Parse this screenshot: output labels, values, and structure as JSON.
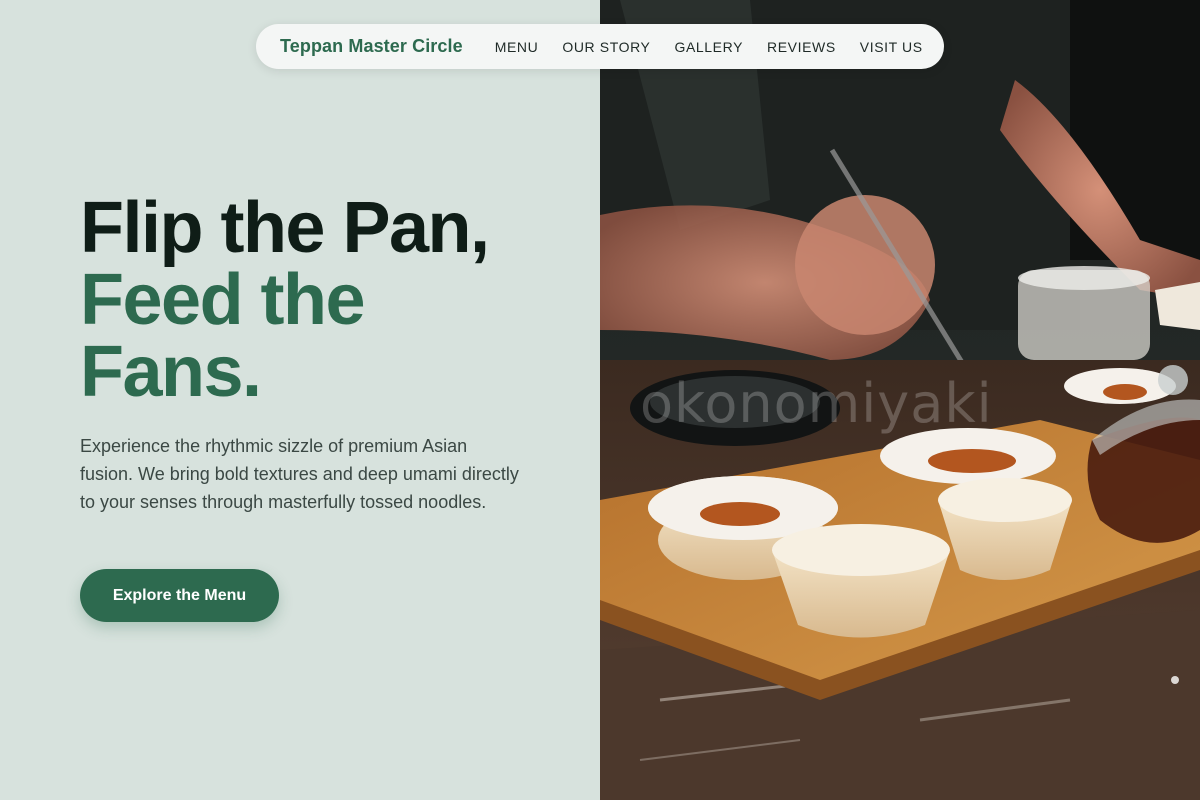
{
  "nav": {
    "brand": "Teppan Master Circle",
    "links": [
      "MENU",
      "OUR STORY",
      "GALLERY",
      "REVIEWS",
      "VISIT US"
    ]
  },
  "hero": {
    "headline_line1": "Flip the Pan,",
    "headline_line2": "Feed the",
    "headline_line3": "Fans.",
    "description": "Experience the rhythmic sizzle of premium Asian fusion. We bring bold textures and deep umami directly to your senses through masterfully tossed noodles.",
    "cta_label": "Explore the Menu"
  },
  "photo": {
    "watermark": "okonomiyaki"
  },
  "colors": {
    "accent": "#2d6a4f",
    "headline_dark": "#0f1d17",
    "panel_bg": "#d7e2dd"
  }
}
